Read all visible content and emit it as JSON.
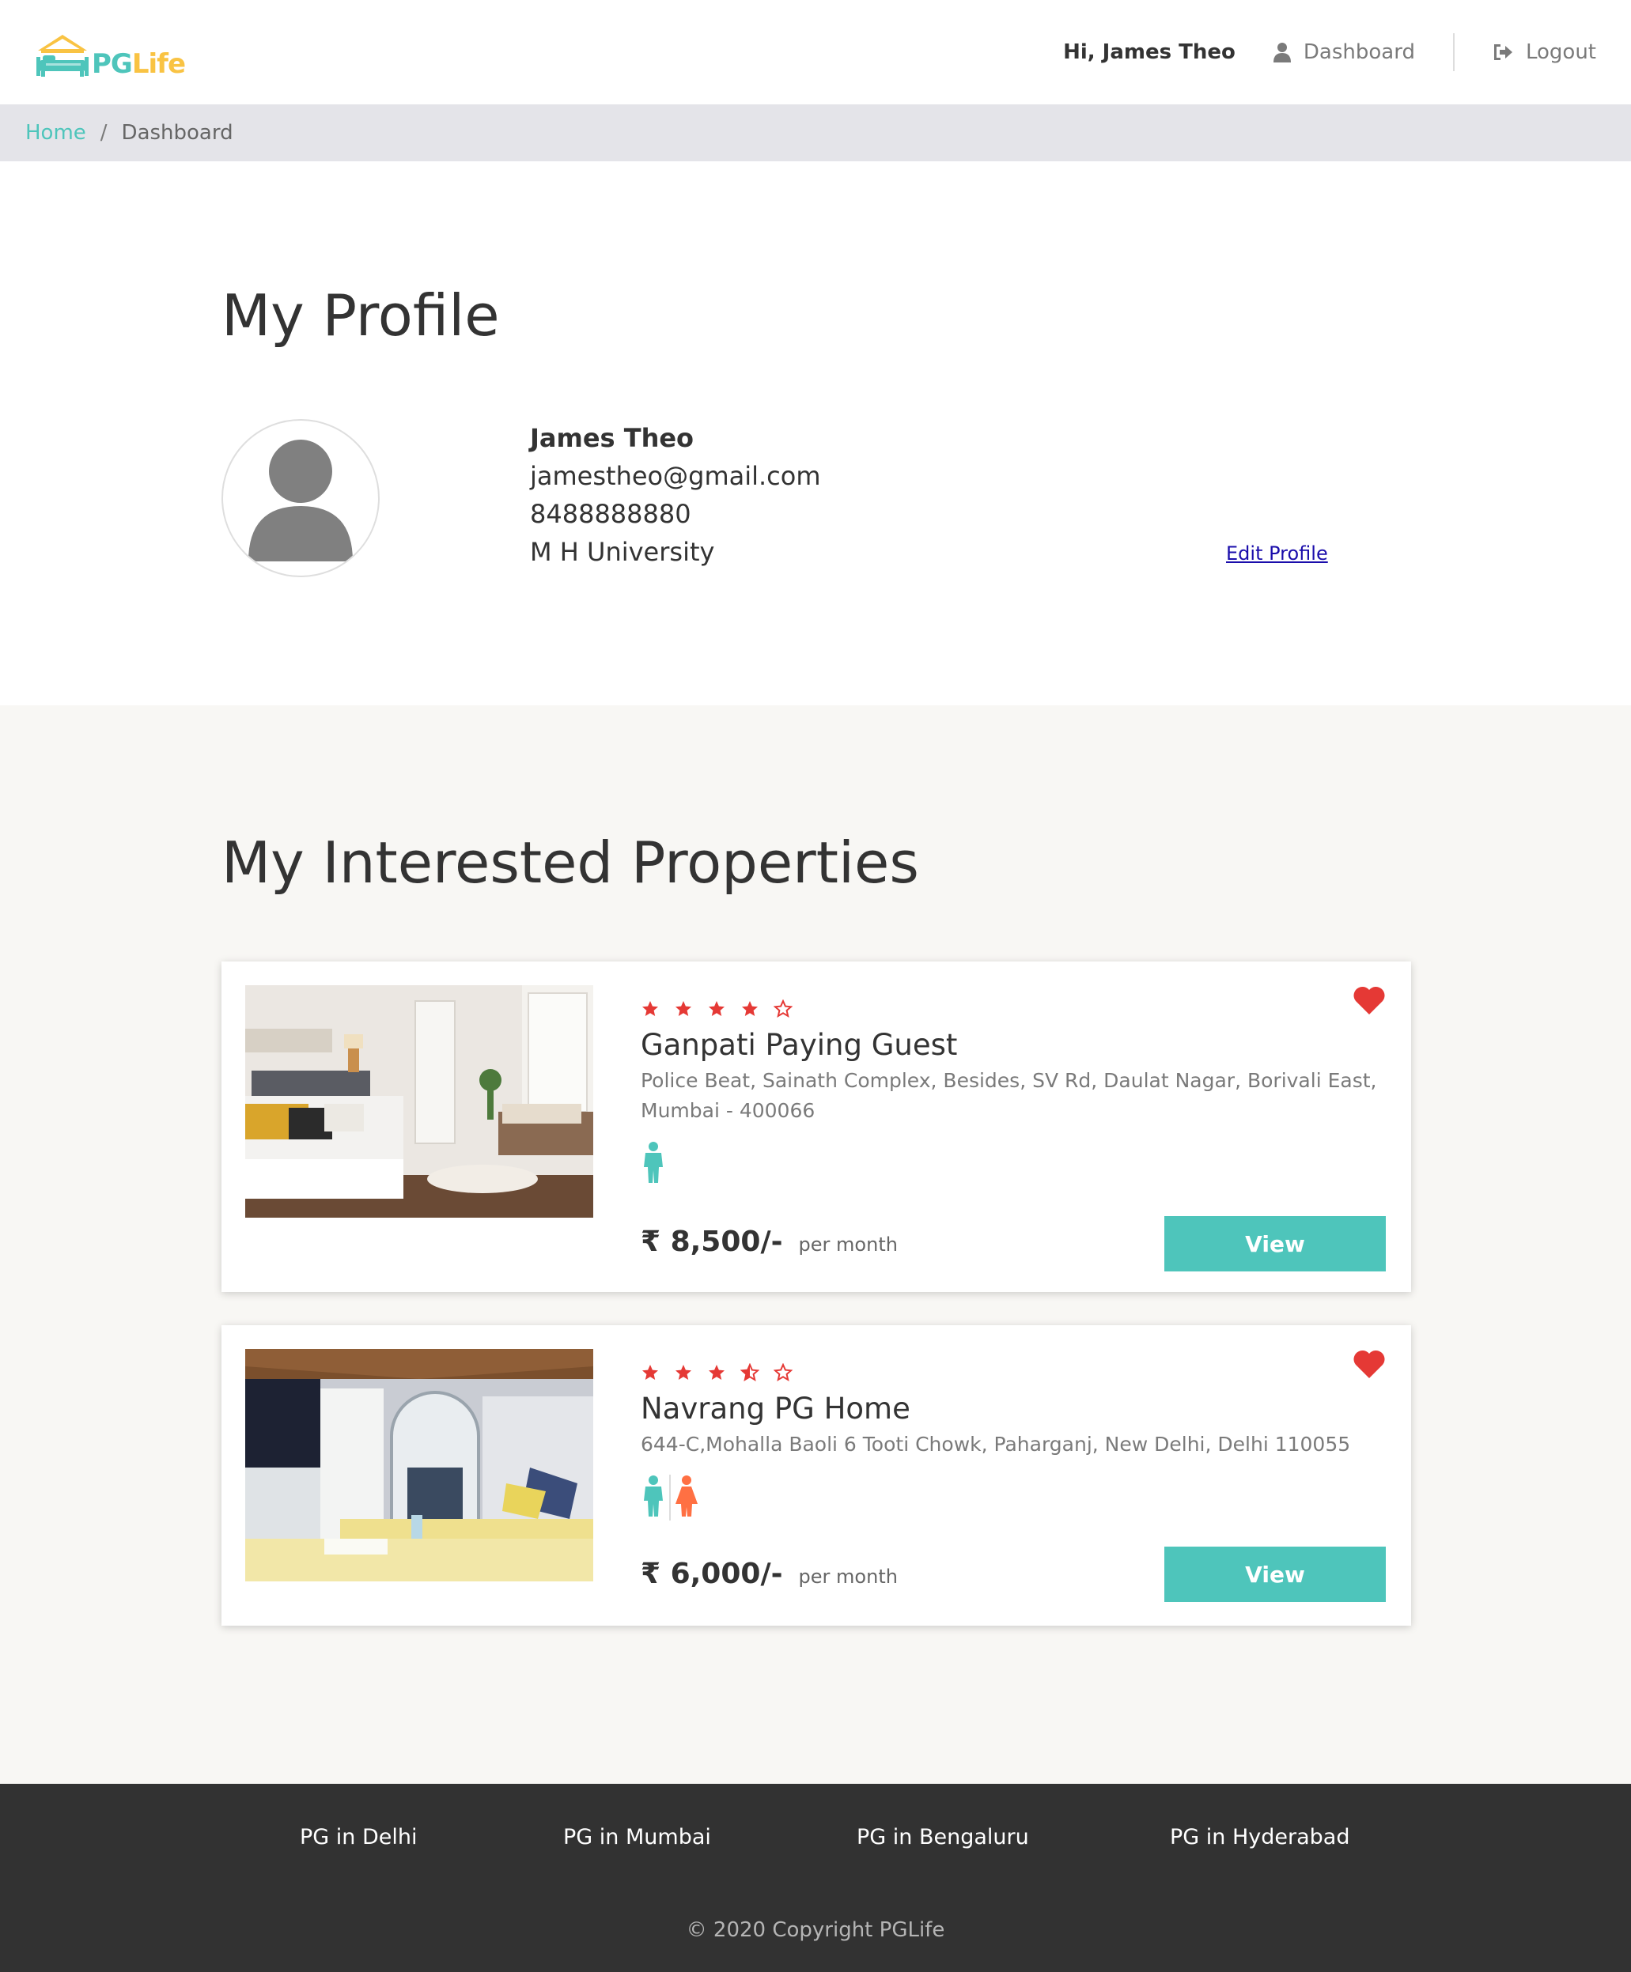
{
  "brand": {
    "pg": "PG",
    "life": "Life"
  },
  "nav": {
    "greeting": "Hi, James Theo",
    "dashboard": "Dashboard",
    "logout": "Logout"
  },
  "breadcrumb": {
    "home": "Home",
    "separator": "/",
    "current": "Dashboard"
  },
  "profile": {
    "title": "My Profile",
    "name": "James Theo",
    "email": "jamestheo@gmail.com",
    "phone": "8488888880",
    "college": "M H University",
    "edit_label": "Edit Profile"
  },
  "properties": {
    "title": "My Interested Properties",
    "items": [
      {
        "name": "Ganpati Paying Guest",
        "address": "Police Beat, Sainath Complex, Besides, SV Rd, Daulat Nagar, Borivali East, Mumbai - 400066",
        "rating": 4,
        "gender": "male",
        "price": "₹ 8,500/-",
        "per": "per month",
        "view_label": "View",
        "interested": true
      },
      {
        "name": "Navrang PG Home",
        "address": "644-C,Mohalla Baoli 6 Tooti Chowk, Paharganj, New Delhi, Delhi 110055",
        "rating": 3.5,
        "gender": "unisex",
        "price": "₹ 6,000/-",
        "per": "per month",
        "view_label": "View",
        "interested": true
      }
    ]
  },
  "footer": {
    "links": [
      "PG in Delhi",
      "PG in Mumbai",
      "PG in Bengaluru",
      "PG in Hyderabad"
    ],
    "copyright": "© 2020 Copyright PGLife"
  },
  "colors": {
    "accent": "#4ec5bb",
    "brand_yellow": "#f9c343",
    "star_red": "#e53935",
    "female_orange": "#ff7043",
    "footer_bg": "#323232",
    "breadcrumb_bg": "#e4e4e9"
  },
  "icons": {
    "logo": "house-bed-icon",
    "dashboard": "user-icon",
    "logout": "sign-out-icon",
    "interested": "heart-icon",
    "male": "male-icon",
    "female": "female-icon",
    "star_full": "star-icon",
    "star_half": "star-half-icon",
    "star_empty": "star-outline-icon"
  }
}
